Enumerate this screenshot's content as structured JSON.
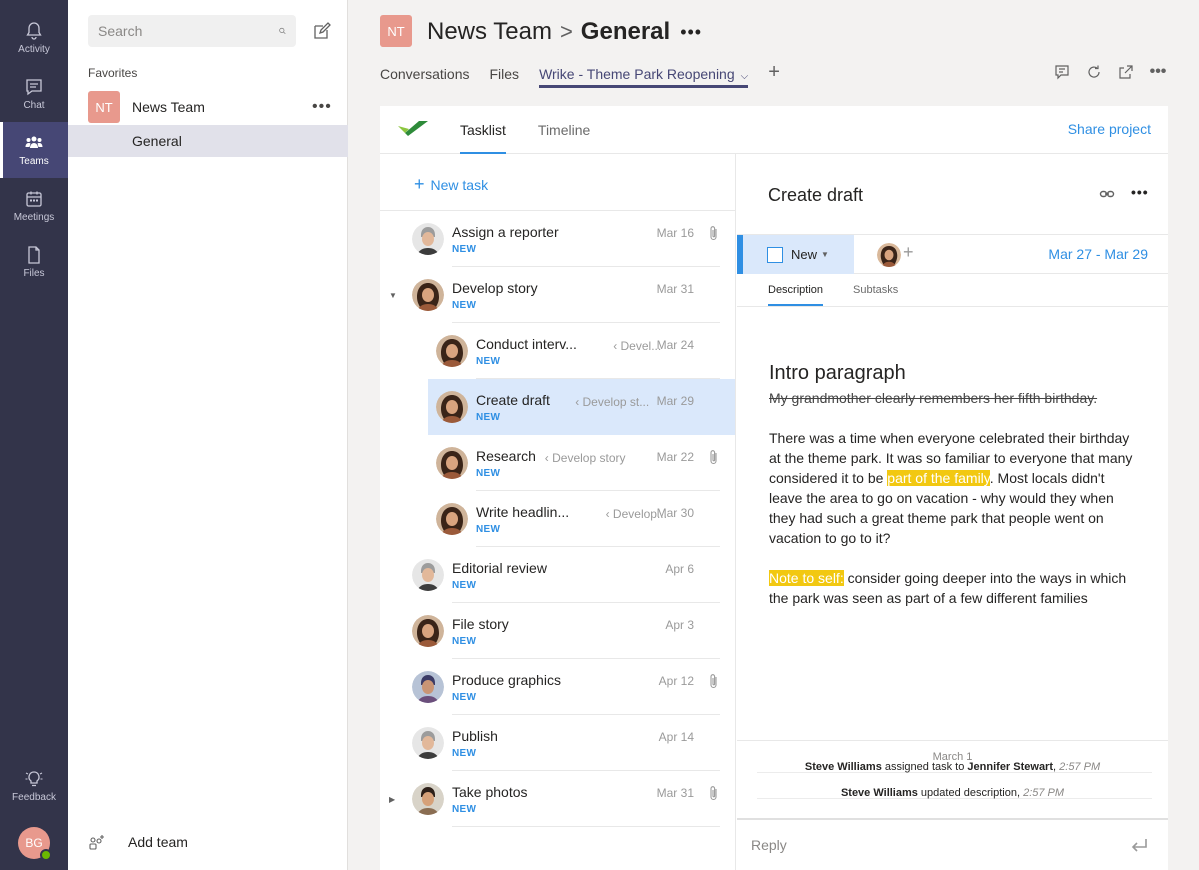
{
  "rail": {
    "items": [
      {
        "label": "Activity",
        "icon": "bell-icon"
      },
      {
        "label": "Chat",
        "icon": "chat-icon"
      },
      {
        "label": "Teams",
        "icon": "teams-icon"
      },
      {
        "label": "Meetings",
        "icon": "calendar-icon"
      },
      {
        "label": "Files",
        "icon": "file-icon"
      }
    ],
    "feedback": "Feedback",
    "user_initials": "BG"
  },
  "left": {
    "search_placeholder": "Search",
    "favorites_label": "Favorites",
    "team": {
      "initials": "NT",
      "name": "News Team",
      "more": "•••"
    },
    "channel": "General",
    "add_team": "Add team"
  },
  "header": {
    "initials": "NT",
    "team": "News Team",
    "separator": ">",
    "channel": "General",
    "more": "•••",
    "tabs": [
      "Conversations",
      "Files",
      "Wrike - Theme Park Reopening"
    ],
    "add_tab": "+"
  },
  "wrike": {
    "tabs": [
      "Tasklist",
      "Timeline"
    ],
    "share": "Share project",
    "new_task": "New task",
    "tasks": [
      {
        "title": "Assign a reporter",
        "status": "NEW",
        "parent": "",
        "date": "Mar 16",
        "clip": true,
        "avatar": "man"
      },
      {
        "title": "Develop story",
        "status": "NEW",
        "parent": "",
        "date": "Mar 31",
        "clip": false,
        "avatar": "woman"
      },
      {
        "title": "Conduct interv...",
        "status": "NEW",
        "parent": "Devel...",
        "date": "Mar 24",
        "clip": false,
        "avatar": "woman"
      },
      {
        "title": "Create draft",
        "status": "NEW",
        "parent": "Develop st...",
        "date": "Mar 29",
        "clip": false,
        "avatar": "woman"
      },
      {
        "title": "Research",
        "status": "NEW",
        "parent": "Develop story",
        "date": "Mar 22",
        "clip": true,
        "avatar": "woman"
      },
      {
        "title": "Write headlin...",
        "status": "NEW",
        "parent": "Develop...",
        "date": "Mar 30",
        "clip": false,
        "avatar": "woman"
      },
      {
        "title": "Editorial review",
        "status": "NEW",
        "parent": "",
        "date": "Apr 6",
        "clip": false,
        "avatar": "man"
      },
      {
        "title": "File story",
        "status": "NEW",
        "parent": "",
        "date": "Apr 3",
        "clip": false,
        "avatar": "woman"
      },
      {
        "title": "Produce graphics",
        "status": "NEW",
        "parent": "",
        "date": "Apr 12",
        "clip": true,
        "avatar": "man2"
      },
      {
        "title": "Publish",
        "status": "NEW",
        "parent": "",
        "date": "Apr 14",
        "clip": false,
        "avatar": "man"
      },
      {
        "title": "Take photos",
        "status": "NEW",
        "parent": "",
        "date": "Mar 31",
        "clip": true,
        "avatar": "man3"
      }
    ],
    "detail": {
      "title": "Create draft",
      "more": "•••",
      "status": "New",
      "dates": "Mar 27 - Mar 29",
      "tabs": [
        "Description",
        "Subtasks"
      ],
      "heading": "Intro paragraph",
      "struck": "My grandmother clearly remembers her fifth birthday.",
      "p1_a": "There was a time when everyone celebrated their birthday at the theme park. It was so familiar to everyone that many considered it to be ",
      "p1_hl": "part of the family",
      "p1_b": ". Most locals didn't leave the area to go on vacation - why would they when they had such a great theme park that people went on vacation to go to it?",
      "p2_hl": "Note to self:",
      "p2_b": " consider going deeper into the ways in which the park was seen as part of a few different families",
      "activity_date": "March 1",
      "activity": [
        {
          "actor": "Steve Williams",
          "action": " assigned task to ",
          "target": "Jennifer Stewart",
          "time": "2:57 PM"
        },
        {
          "actor": "Steve Williams",
          "action": " updated description",
          "target": "",
          "time": "2:57 PM"
        }
      ],
      "reply_placeholder": "Reply"
    }
  },
  "colors": {
    "rail": "#33344a",
    "accent": "#464775",
    "wrike_blue": "#2f8fe3",
    "highlight": "#f2c811",
    "avatar": "#e8998d"
  }
}
